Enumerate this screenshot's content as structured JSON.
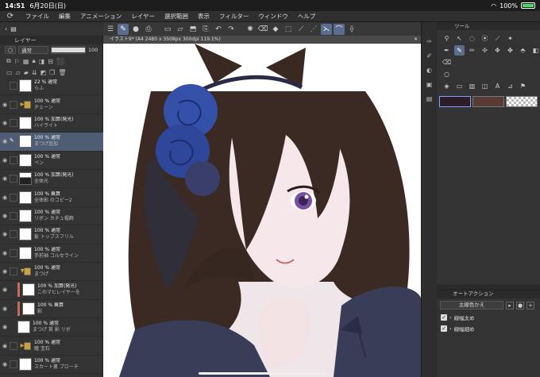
{
  "status": {
    "time": "14:51",
    "date": "6月20日(日)",
    "battery": "100%"
  },
  "menu": [
    "ファイル",
    "編集",
    "アニメーション",
    "レイヤー",
    "選択範囲",
    "表示",
    "フィルター",
    "ウィンドウ",
    "ヘルプ"
  ],
  "layer_panel": {
    "title": "レイヤー",
    "blend_mode": "通常",
    "opacity": "100"
  },
  "layers": [
    {
      "pct": "22 % 通常",
      "name": "らふ",
      "type": "layer",
      "selected": false
    },
    {
      "pct": "100 % 通常",
      "name": "チェーン",
      "type": "folder",
      "selected": false
    },
    {
      "pct": "100 % 加算(発光)",
      "name": "ハイライト",
      "type": "layer",
      "selected": false
    },
    {
      "pct": "100 % 通常",
      "name": "まつげ追加",
      "type": "layer",
      "selected": true
    },
    {
      "pct": "100 % 通常",
      "name": "ペン",
      "type": "layer",
      "selected": false
    },
    {
      "pct": "100 % 加算(発光)",
      "name": "全体光",
      "type": "layer",
      "selected": false
    },
    {
      "pct": "100 % 乗算",
      "name": "全体影 のコピー2",
      "type": "layer",
      "selected": false
    },
    {
      "pct": "100 % 通常",
      "name": "リボン カチュ帽飾",
      "type": "layer",
      "selected": false
    },
    {
      "pct": "100 % 通常",
      "name": "髪 トップスフリル",
      "type": "layer",
      "selected": false
    },
    {
      "pct": "100 % 通常",
      "name": "手前袖 コルセライン",
      "type": "layer",
      "selected": false
    },
    {
      "pct": "100 % 通常",
      "name": "まつげ",
      "type": "folder",
      "selected": false
    },
    {
      "pct": "100 % 加算(発光)",
      "name": "このマヒレイヤーを",
      "type": "clip",
      "selected": false
    },
    {
      "pct": "100 % 乗算",
      "name": "影",
      "type": "clip",
      "selected": false
    },
    {
      "pct": "100 % 通常",
      "name": "まつげ 首 影 リボ",
      "type": "layer",
      "selected": false
    },
    {
      "pct": "100 % 通常",
      "name": "瞳 宝石",
      "type": "folder",
      "selected": false
    },
    {
      "pct": "100 % 通常",
      "name": "スカート裏 ブローチ",
      "type": "layer",
      "selected": false
    }
  ],
  "canvas": {
    "tab_title": "イラスト9* (A4 2480 x 3508px 300dpi 119.1%)"
  },
  "tool_panel": {
    "title": "ツール"
  },
  "colors": {
    "main": "#2c1d2b",
    "sub": "#5a3a34",
    "accent": "#5a6d8c",
    "hair": "#3b2a24",
    "rose": "#3550a8"
  },
  "auto_action": {
    "title": "オートアクション",
    "set_name": "主線色かえ",
    "items": [
      "線幅太め",
      "線幅細め"
    ]
  }
}
